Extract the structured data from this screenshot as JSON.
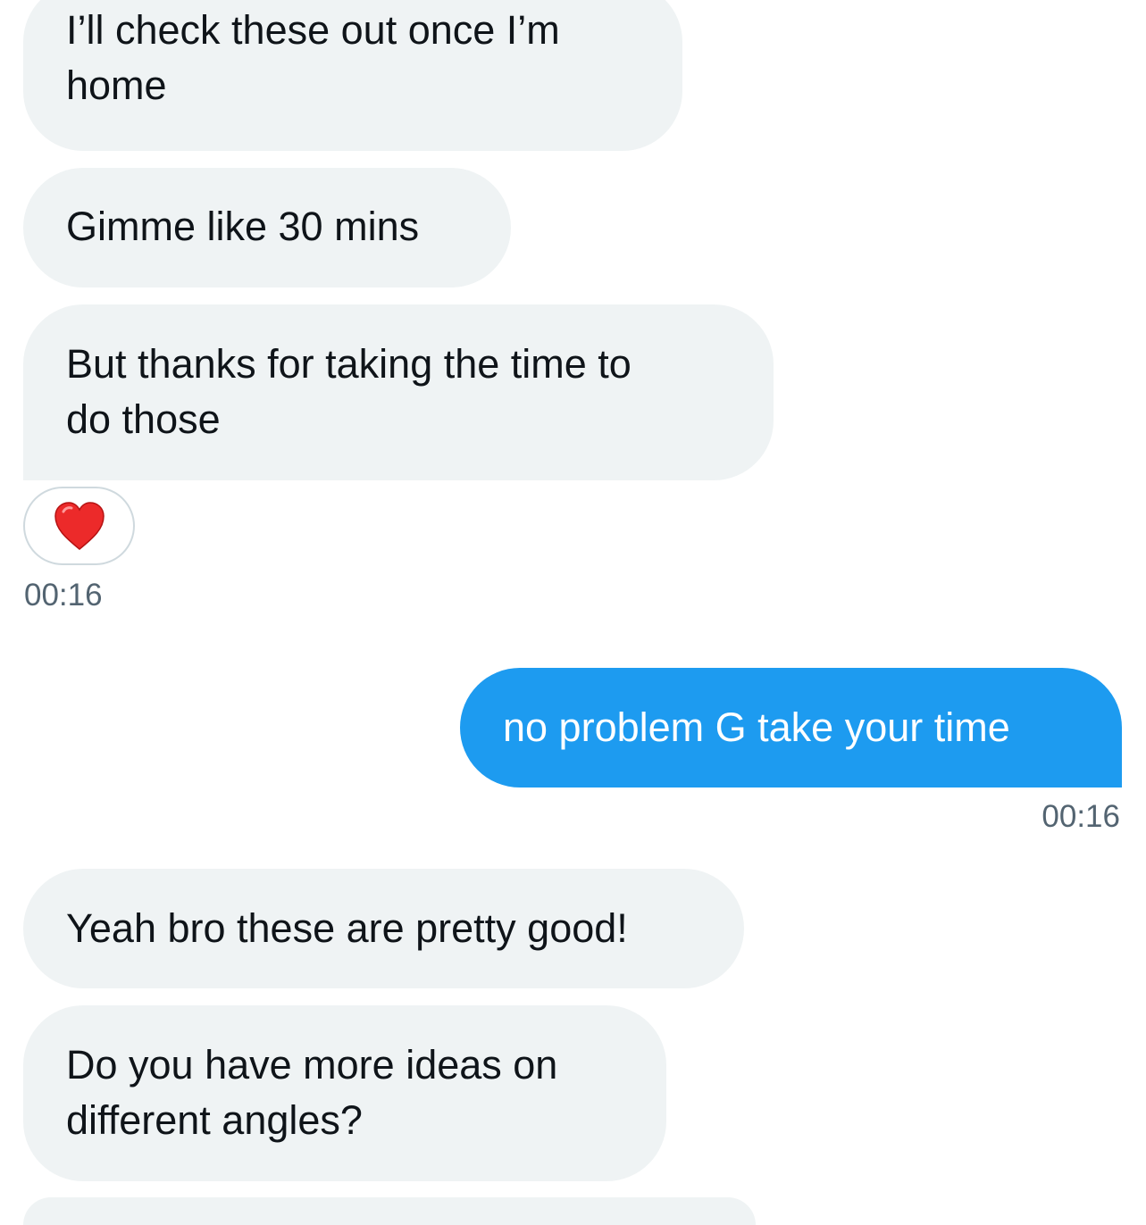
{
  "messages": [
    {
      "lines": [
        "I’ll check these out once I’m",
        "home"
      ],
      "direction": "incoming"
    },
    {
      "lines": [
        "Gimme like 30 mins"
      ],
      "direction": "incoming"
    },
    {
      "lines": [
        "But thanks for taking the time to",
        "do those"
      ],
      "direction": "incoming"
    },
    {
      "lines": [
        "no problem G take your time"
      ],
      "direction": "outgoing"
    },
    {
      "lines": [
        "Yeah bro these are pretty good!"
      ],
      "direction": "incoming"
    },
    {
      "lines": [
        "Do you have more ideas on",
        "different angles?"
      ],
      "direction": "incoming"
    }
  ],
  "reaction": {
    "emoji": "red-heart",
    "color": "#ec2a2a"
  },
  "timestamps": {
    "incoming": "00:16",
    "outgoing": "00:16"
  },
  "colors": {
    "incoming_bubble": "#eff3f4",
    "outgoing_bubble": "#1d9bf0",
    "text": "#0f1419",
    "timestamp": "#536471"
  }
}
